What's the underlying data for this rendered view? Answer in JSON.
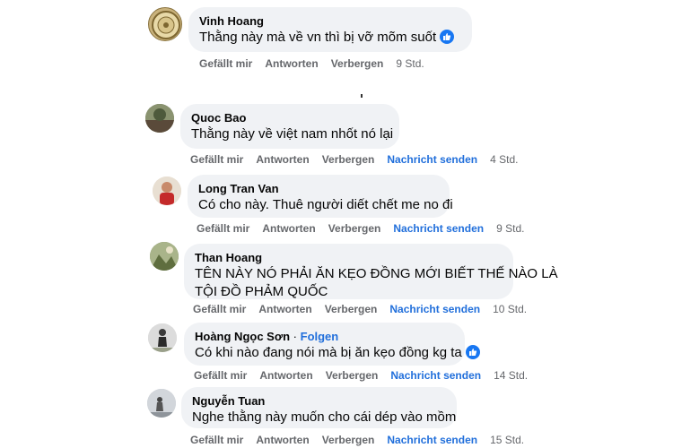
{
  "actions": {
    "like": "Gefällt mir",
    "reply": "Antworten",
    "hide": "Verbergen",
    "message": "Nachricht senden"
  },
  "comments": [
    {
      "author": "Vinh Hoang",
      "text": "Thằng này mà về vn thì bị vỡ mõm suốt",
      "time": "9 Std."
    },
    {
      "author": "Quoc Bao",
      "text": "Thằng này về việt nam nhốt nó lại",
      "time": "4 Std."
    },
    {
      "author": "Long Tran Van",
      "text": "Có cho này. Thuê người diết chết me no đi",
      "time": "9 Std."
    },
    {
      "author": "Than Hoang",
      "text_line1": "TÊN NÀY NÓ PHẢI ĂN KẸO ĐỒNG MỚI BIẾT THẾ NÀO LÀ",
      "text_line2": "TỘI ĐỒ PHẢM QUỐC",
      "time": "10 Std."
    },
    {
      "author": "Hoàng Ngọc Sơn",
      "follow": "Folgen",
      "separator": "·",
      "text": "Có khi nào đang nói mà bị ăn kẹo đồng kg ta",
      "time": "14 Std."
    },
    {
      "author": "Nguyễn Tuan",
      "text": "Nghe thằng này muốn cho cái dép vào mồm",
      "time": "15 Std."
    }
  ],
  "colors": {
    "bubble": "#f0f2f5",
    "link": "#216fdb",
    "meta": "#65676b",
    "like": "#1877f2"
  }
}
